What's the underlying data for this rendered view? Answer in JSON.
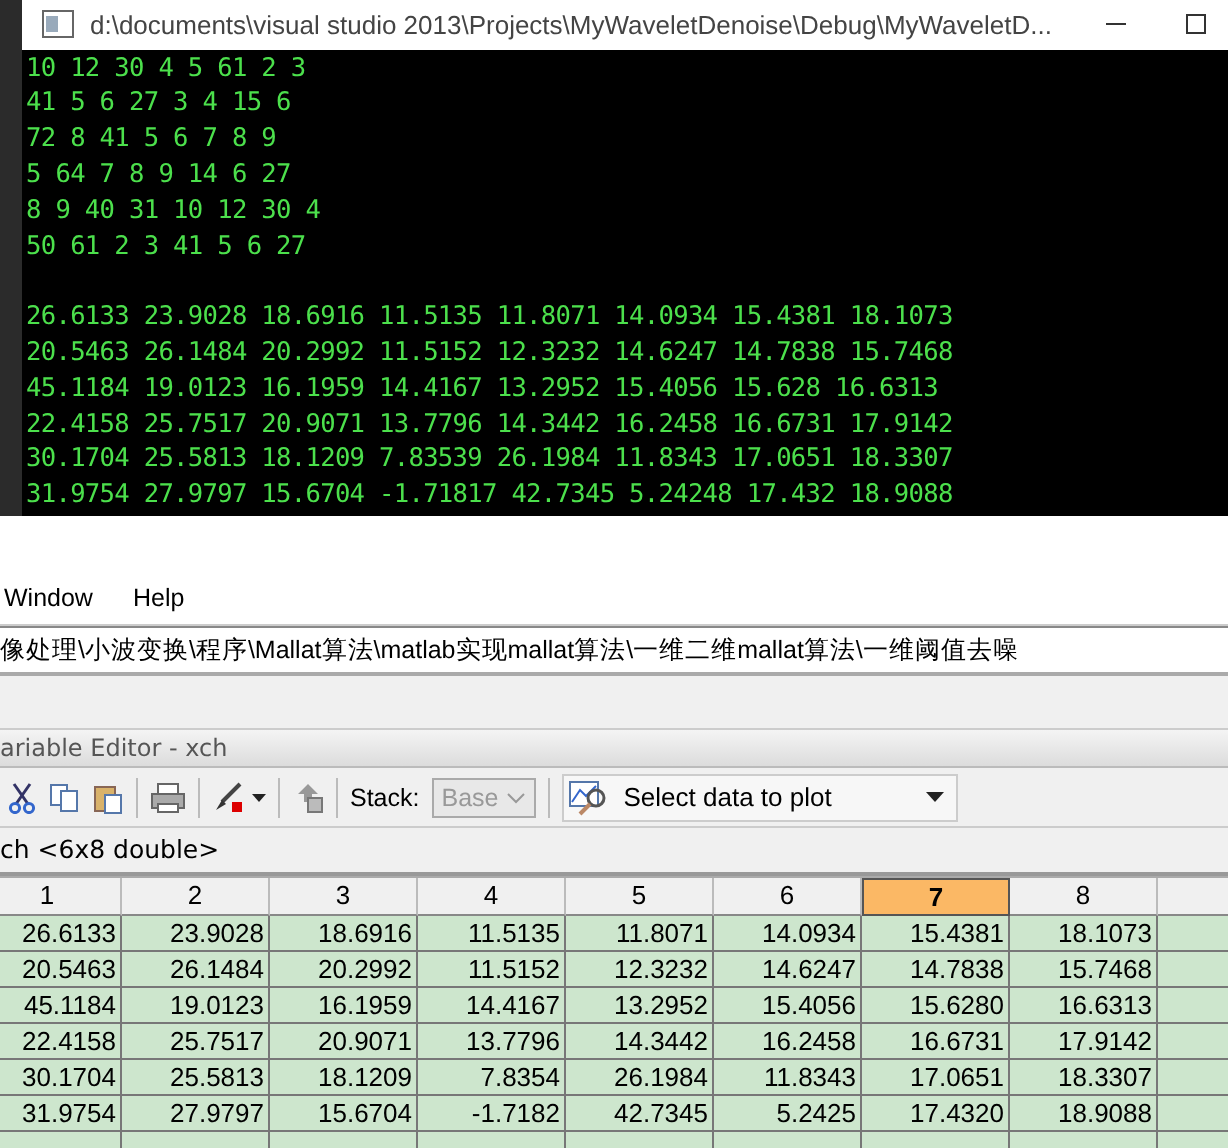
{
  "console": {
    "title": "d:\\documents\\visual studio 2013\\Projects\\MyWaveletDenoise\\Debug\\MyWaveletD...",
    "int_lines": [
      "10 12 30 4 5 61 2 3",
      "41 5 6 27 3 4 15 6",
      "72 8 41 5 6 7 8 9",
      "5 64 7 8 9 14 6 27",
      "8 9 40 31 10 12 30 4",
      "50 61 2 3 41 5 6 27"
    ],
    "float_lines": [
      "26.6133 23.9028 18.6916 11.5135 11.8071 14.0934 15.4381 18.1073",
      "20.5463 26.1484 20.2992 11.5152 12.3232 14.6247 14.7838 15.7468",
      "45.1184 19.0123 16.1959 14.4167 13.2952 15.4056 15.628 16.6313",
      "22.4158 25.7517 20.9071 13.7796 14.3442 16.2458 16.6731 17.9142",
      "30.1704 25.5813 18.1209 7.83539 26.1984 11.8343 17.0651 18.3307",
      "31.9754 27.9797 15.6704 -1.71817 42.7345 5.24248 17.432 18.9088"
    ]
  },
  "menu": [
    "Window",
    "Help"
  ],
  "path": "像处理\\小波变换\\程序\\Mallat算法\\matlab实现mallat算法\\一维二维mallat算法\\一维阈值去噪",
  "editor": {
    "title": "ariable Editor - xch",
    "toolbar": {
      "stack_label": "Stack:",
      "stack_value": "Base",
      "stack_disabled": true,
      "plot_button": "Select data to plot"
    },
    "variable": "ch <6x8 double>",
    "columns": [
      {
        "label": "1",
        "selected": false
      },
      {
        "label": "2",
        "selected": false
      },
      {
        "label": "3",
        "selected": false
      },
      {
        "label": "4",
        "selected": false
      },
      {
        "label": "5",
        "selected": false
      },
      {
        "label": "6",
        "selected": false
      },
      {
        "label": "7",
        "selected": true
      },
      {
        "label": "8",
        "selected": false
      }
    ],
    "rows": [
      [
        "26.6133",
        "23.9028",
        "18.6916",
        "11.5135",
        "11.8071",
        "14.0934",
        "15.4381",
        "18.1073"
      ],
      [
        "20.5463",
        "26.1484",
        "20.2992",
        "11.5152",
        "12.3232",
        "14.6247",
        "14.7838",
        "15.7468"
      ],
      [
        "45.1184",
        "19.0123",
        "16.1959",
        "14.4167",
        "13.2952",
        "15.4056",
        "15.6280",
        "16.6313"
      ],
      [
        "22.4158",
        "25.7517",
        "20.9071",
        "13.7796",
        "14.3442",
        "16.2458",
        "16.6731",
        "17.9142"
      ],
      [
        "30.1704",
        "25.5813",
        "18.1209",
        "7.8354",
        "26.1984",
        "11.8343",
        "17.0651",
        "18.3307"
      ],
      [
        "31.9754",
        "27.9797",
        "15.6704",
        "-1.7182",
        "42.7345",
        "5.2425",
        "17.4320",
        "18.9088"
      ]
    ]
  }
}
